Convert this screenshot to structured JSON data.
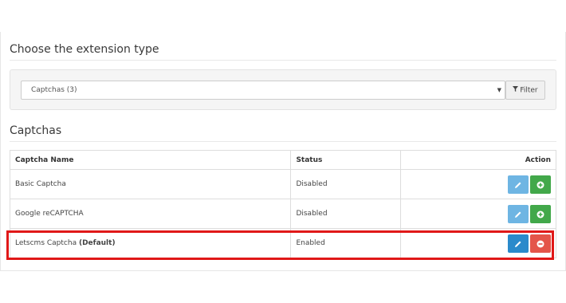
{
  "extension_section": {
    "heading": "Choose the extension type",
    "select_value": "Captchas (3)",
    "filter_label": "Filter"
  },
  "captchas": {
    "heading": "Captchas",
    "columns": {
      "name": "Captcha Name",
      "status": "Status",
      "action": "Action"
    },
    "rows": [
      {
        "name": "Basic Captcha",
        "default_tag": "",
        "status": "Disabled",
        "install_state": "not-installed"
      },
      {
        "name": "Google reCAPTCHA",
        "default_tag": "",
        "status": "Disabled",
        "install_state": "not-installed"
      },
      {
        "name": "Letscms Captcha",
        "default_tag": "(Default)",
        "status": "Enabled",
        "install_state": "installed",
        "highlighted": true
      }
    ]
  },
  "colors": {
    "edit": "#6eb5e3",
    "edit_active": "#2a8acb",
    "install": "#42a84a",
    "uninstall": "#e4554a",
    "highlight": "#e01818"
  },
  "icons": {
    "edit": "pencil-icon",
    "install": "plus-circle-icon",
    "uninstall": "minus-circle-icon",
    "filter": "funnel-icon",
    "select": "caret-down-icon"
  }
}
